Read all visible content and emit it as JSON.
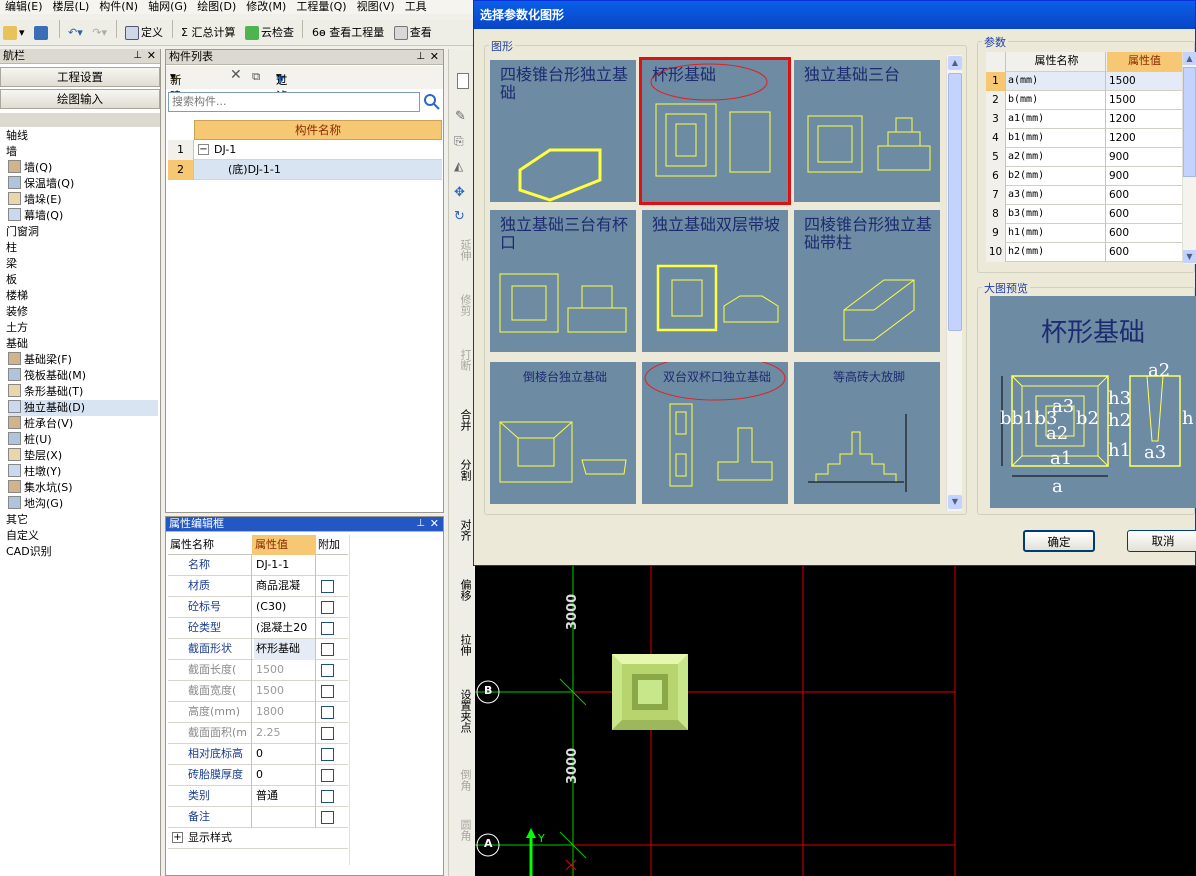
{
  "menu": [
    "编辑(E)",
    "楼层(L)",
    "构件(N)",
    "轴网(G)",
    "绘图(D)",
    "修改(M)",
    "工程量(Q)",
    "视图(V)",
    "工具"
  ],
  "toolbar": {
    "define": "定义",
    "sum_calc": "汇总计算",
    "cloud_check": "云检查",
    "view_qty": "查看工程量",
    "view_more": "查看"
  },
  "nav": {
    "title": "航栏",
    "project_settings": "工程设置",
    "draw_input": "绘图输入",
    "items": [
      {
        "label": "轴线",
        "indent": 0
      },
      {
        "label": "墙",
        "indent": 0
      },
      {
        "label": "墙(Q)",
        "indent": 1
      },
      {
        "label": "保温墙(Q)",
        "indent": 1
      },
      {
        "label": "墙垛(E)",
        "indent": 1
      },
      {
        "label": "幕墙(Q)",
        "indent": 1
      },
      {
        "label": "门窗洞",
        "indent": 0
      },
      {
        "label": "柱",
        "indent": 0
      },
      {
        "label": "梁",
        "indent": 0
      },
      {
        "label": "板",
        "indent": 0
      },
      {
        "label": "楼梯",
        "indent": 0
      },
      {
        "label": "装修",
        "indent": 0
      },
      {
        "label": "土方",
        "indent": 0
      },
      {
        "label": "基础",
        "indent": 0
      },
      {
        "label": "基础梁(F)",
        "indent": 1
      },
      {
        "label": "筏板基础(M)",
        "indent": 1
      },
      {
        "label": "条形基础(T)",
        "indent": 1
      },
      {
        "label": "独立基础(D)",
        "indent": 1,
        "selected": true
      },
      {
        "label": "桩承台(V)",
        "indent": 1
      },
      {
        "label": "桩(U)",
        "indent": 1
      },
      {
        "label": "垫层(X)",
        "indent": 1
      },
      {
        "label": "柱墩(Y)",
        "indent": 1
      },
      {
        "label": "集水坑(S)",
        "indent": 1
      },
      {
        "label": "地沟(G)",
        "indent": 1
      },
      {
        "label": "其它",
        "indent": 0
      },
      {
        "label": "自定义",
        "indent": 0
      },
      {
        "label": "CAD识别",
        "indent": 0
      }
    ]
  },
  "component_list": {
    "title": "构件列表",
    "new": "新建",
    "filter": "过滤",
    "search_placeholder": "搜索构件...",
    "column": "构件名称",
    "rows": [
      {
        "num": "1",
        "name": "DJ-1"
      },
      {
        "num": "2",
        "name": "(底)DJ-1-1"
      }
    ]
  },
  "property_editor": {
    "title": "属性编辑框",
    "col_name": "属性名称",
    "col_value": "属性值",
    "col_extra": "附加",
    "rows": [
      {
        "name": "名称",
        "value": "DJ-1-1",
        "cb": false,
        "gray": false
      },
      {
        "name": "材质",
        "value": "商品混凝",
        "cb": true,
        "gray": false
      },
      {
        "name": "砼标号",
        "value": "(C30)",
        "cb": true,
        "gray": false
      },
      {
        "name": "砼类型",
        "value": "(混凝土20",
        "cb": true,
        "gray": false
      },
      {
        "name": "截面形状",
        "value": "杯形基础",
        "cb": true,
        "gray": false
      },
      {
        "name": "截面长度(",
        "value": "1500",
        "cb": true,
        "gray": true
      },
      {
        "name": "截面宽度(",
        "value": "1500",
        "cb": true,
        "gray": true
      },
      {
        "name": "高度(mm)",
        "value": "1800",
        "cb": true,
        "gray": true
      },
      {
        "name": "截面面积(m",
        "value": "2.25",
        "cb": true,
        "gray": true
      },
      {
        "name": "相对底标高",
        "value": "0",
        "cb": true,
        "gray": false
      },
      {
        "name": "砖胎膜厚度",
        "value": "0",
        "cb": true,
        "gray": false
      },
      {
        "name": "类别",
        "value": "普通",
        "cb": true,
        "gray": false
      },
      {
        "name": "备注",
        "value": "",
        "cb": true,
        "gray": false
      }
    ],
    "show_style": "显示样式"
  },
  "vertical_tools": [
    "延伸",
    "修剪",
    "打断",
    "合并",
    "分割",
    "对齐",
    "偏移",
    "拉伸",
    "设置夹点",
    "倒角",
    "圆角"
  ],
  "dialog": {
    "title": "选择参数化图形",
    "group_shapes": "图形",
    "group_params": "参数",
    "group_preview": "大图预览",
    "ok": "确定",
    "cancel": "取消",
    "shapes": [
      {
        "title": "四棱锥台形独立基础"
      },
      {
        "title": "杯形基础",
        "selected": true
      },
      {
        "title": "独立基础三台"
      },
      {
        "title": "独立基础三台有杯口"
      },
      {
        "title": "独立基础双层带坡"
      },
      {
        "title": "四棱锥台形独立基础带柱"
      },
      {
        "title": "倒棱台独立基础"
      },
      {
        "title": "双台双杯口独立基础"
      },
      {
        "title": "等高砖大放脚"
      }
    ],
    "param_headers": {
      "name": "属性名称",
      "value": "属性值"
    },
    "params": [
      {
        "i": "1",
        "name": "a(mm)",
        "value": "1500"
      },
      {
        "i": "2",
        "name": "b(mm)",
        "value": "1500"
      },
      {
        "i": "3",
        "name": "a1(mm)",
        "value": "1200"
      },
      {
        "i": "4",
        "name": "b1(mm)",
        "value": "1200"
      },
      {
        "i": "5",
        "name": "a2(mm)",
        "value": "900"
      },
      {
        "i": "6",
        "name": "b2(mm)",
        "value": "900"
      },
      {
        "i": "7",
        "name": "a3(mm)",
        "value": "600"
      },
      {
        "i": "8",
        "name": "b3(mm)",
        "value": "600"
      },
      {
        "i": "9",
        "name": "h1(mm)",
        "value": "600"
      },
      {
        "i": "10",
        "name": "h2(mm)",
        "value": "600"
      }
    ],
    "preview_title": "杯形基础"
  },
  "cad": {
    "axis_b": "B",
    "axis_a": "A",
    "dim_upper": "3000",
    "dim_lower": "3000",
    "y_label": "Y"
  },
  "colors": {
    "title_bar": "#0a4fd4",
    "tile_bg": "#6d8ba3",
    "header_orange": "#f6c874",
    "selection_red": "#e01010"
  }
}
